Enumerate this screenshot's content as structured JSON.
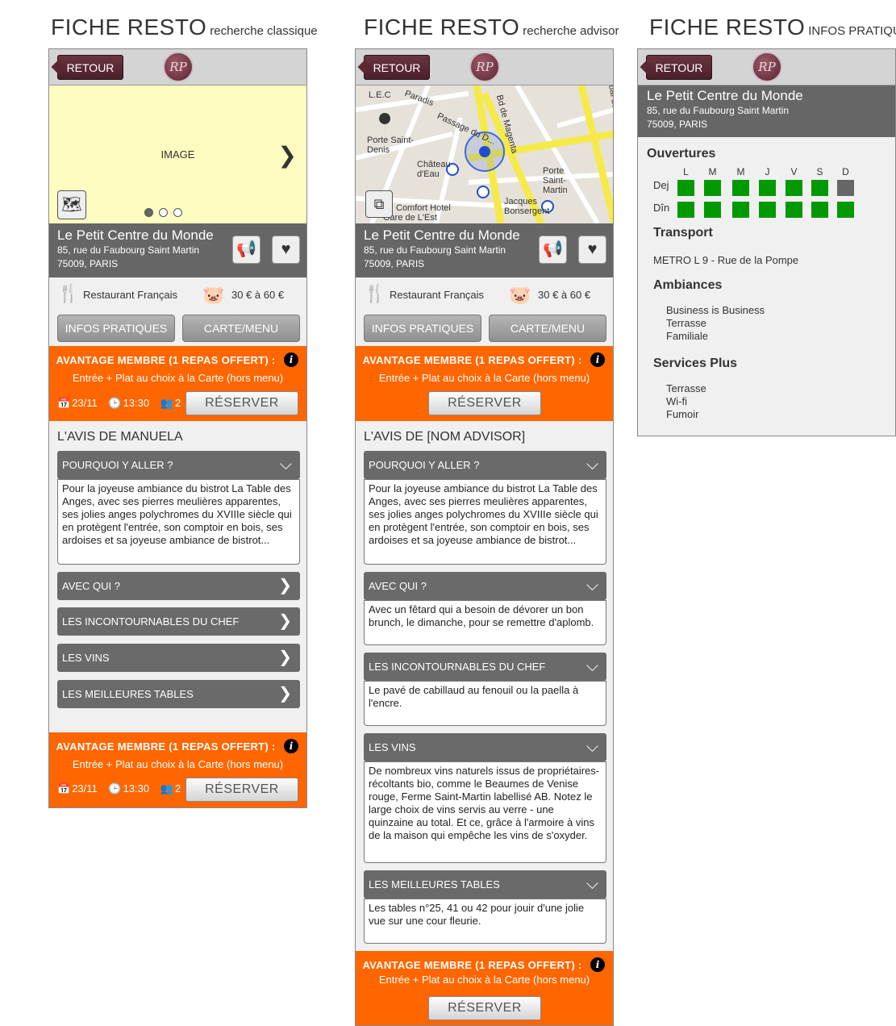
{
  "titles": [
    {
      "big": "FICHE RESTO",
      "small": "recherche classique"
    },
    {
      "big": "FICHE RESTO",
      "small": "recherche advisor"
    },
    {
      "big": "FICHE RESTO",
      "small": "INFOS PRATIQUES"
    }
  ],
  "common": {
    "retour": "RETOUR",
    "logo": "RP",
    "resto_name": "Le Petit Centre du Monde",
    "addr1": "85, rue du Faubourg Saint Martin",
    "addr2": "75009, PARIS",
    "cuisine": "Restaurant Français",
    "price": "30 € à 60 €",
    "btn_infos": "INFOS PRATIQUES",
    "btn_carte": "CARTE/MENU",
    "avantage_head": "AVANTAGE MEMBRE (1 REPAS OFFERT) :",
    "avantage_sub": "Entrée + Plat au choix à la Carte (hors menu)",
    "info_i": "i",
    "date": "23/11",
    "time": "13:30",
    "people": "2",
    "reserver": "RÉSERVER"
  },
  "icons": {
    "next": "chevron-right-icon",
    "gallery": "map-book-icon",
    "megaphone": "megaphone-icon",
    "heart": "heart-icon",
    "fork": "cutlery-icon",
    "pig": "piggy-bank-icon",
    "calendar": "calendar-icon",
    "clock": "clock-icon",
    "people": "people-icon",
    "chevron_down": "chevron-down-icon",
    "pin": "map-pin-icon",
    "metro": "metro-icon"
  },
  "colors": {
    "orange": "#ff6600",
    "band": "#666666",
    "retour": "#5a2834",
    "open_day": "#009900",
    "closed_day": "#666666",
    "image_placeholder": "#fcfcc0"
  },
  "screen1": {
    "image_label": "IMAGE",
    "avis_title": "L'AVIS DE MANUELA",
    "accordion": [
      {
        "label": "POURQUOI Y ALLER ?",
        "open": true,
        "body": "Pour la joyeuse ambiance du bistrot La Table des Anges, avec ses pierres meulières apparentes, ses jolies anges polychromes du XVIIIe siècle qui en protègent l'entrée, son comptoir en bois, ses ardoises et sa joyeuse ambiance de bistrot..."
      },
      {
        "label": "AVEC QUI ?",
        "open": false
      },
      {
        "label": "LES INCONTOURNABLES DU CHEF",
        "open": false
      },
      {
        "label": "LES VINS",
        "open": false
      },
      {
        "label": "LES MEILLEURES TABLES",
        "open": false
      }
    ]
  },
  "screen2": {
    "map_labels": [
      "L.E.C",
      "Porte Saint-Denis",
      "Passage du D...",
      "Château d'Eau",
      "Porte Saint-Martin",
      "Jacques Bonsergent",
      "Bd de Magenta",
      "Gare de L'Est",
      "Comfort Hotel",
      "Quai de Valmy",
      "Paradis"
    ],
    "avis_title": "L'AVIS DE [NOM ADVISOR]",
    "accordion": [
      {
        "label": "POURQUOI Y ALLER ?",
        "body": "Pour la joyeuse ambiance du bistrot La Table des Anges, avec ses pierres meulières apparentes, ses jolies anges polychromes du XVIIIe siècle qui en protègent l'entrée, son comptoir en bois, ses ardoises et sa joyeuse ambiance de bistrot..."
      },
      {
        "label": "AVEC QUI ?",
        "body": "Avec un fêtard qui a besoin de dévorer un bon brunch, le dimanche, pour se remettre d'aplomb."
      },
      {
        "label": "LES INCONTOURNABLES DU CHEF",
        "body": "Le pavé de cabillaud au fenouil ou la paella à l'encre."
      },
      {
        "label": "LES VINS",
        "body": "De nombreux vins naturels issus de propriétaires-récoltants bio, comme le Beaumes de Venise rouge, Ferme Saint-Martin labellisé AB. Notez le large choix de vins servis au verre - une quinzaine au total. Et ce, grâce à l'armoire à vins de la maison qui empêche les vins de s'oxyder."
      },
      {
        "label": "LES MEILLEURES TABLES",
        "body": "Les tables n°25, 41 ou 42 pour jouir d'une jolie vue sur une cour fleurie."
      }
    ]
  },
  "screen3": {
    "ouvertures": "Ouvertures",
    "days": [
      "L",
      "M",
      "M",
      "J",
      "V",
      "S",
      "D"
    ],
    "row_dej": "Dej",
    "row_din": "Dîn",
    "dej_open": [
      true,
      true,
      true,
      true,
      true,
      true,
      false
    ],
    "din_open": [
      true,
      true,
      true,
      true,
      true,
      true,
      true
    ],
    "transport": "Transport",
    "transport_line": "METRO L 9 - Rue de la Pompe",
    "ambiances": "Ambiances",
    "ambiances_list": [
      "Business is Business",
      "Terrasse",
      "Familiale"
    ],
    "services": "Services Plus",
    "services_list": [
      "Terrasse",
      "Wi-fi",
      "Fumoir"
    ]
  }
}
